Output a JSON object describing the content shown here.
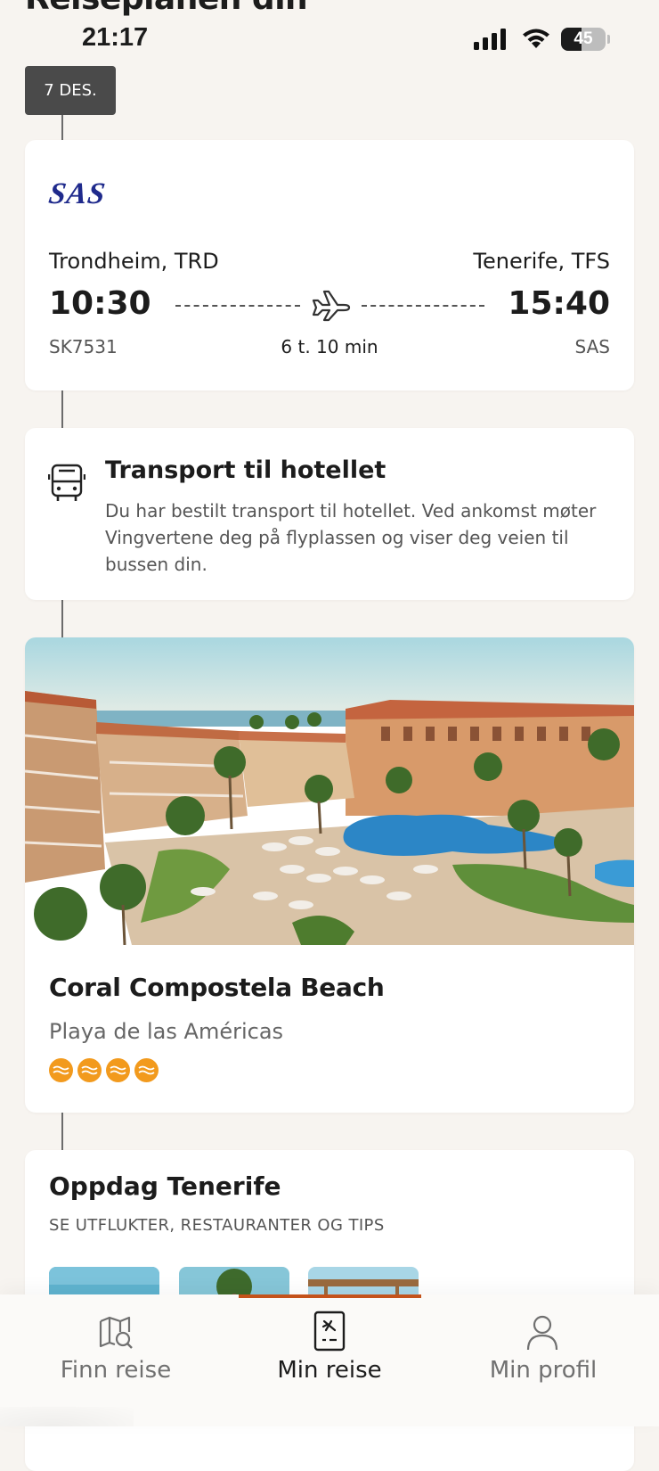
{
  "page": {
    "heading": "Reiseplanen din"
  },
  "status_bar": {
    "time": "21:17",
    "battery_percent": 45,
    "battery_label": "45"
  },
  "timeline": {
    "date_label": "7 DES."
  },
  "flight": {
    "airline_logo_text": "SAS",
    "from": "Trondheim, TRD",
    "to": "Tenerife, TFS",
    "departure_time": "10:30",
    "arrival_time": "15:40",
    "flight_number": "SK7531",
    "duration": "6 t. 10 min",
    "airline": "SAS",
    "icon": "airplane-icon"
  },
  "transport": {
    "icon": "bus-icon",
    "title": "Transport til hotellet",
    "description": "Du har bestilt transport til hotellet. Ved ankomst møter Vingvertene deg på flyplassen og viser deg veien til bussen din."
  },
  "hotel": {
    "name": "Coral Compostela Beach",
    "location": "Playa de las Américas",
    "rating": 4,
    "rating_icon": "sun-rating-icon",
    "rating_color": "#f29a1d"
  },
  "discover": {
    "title": "Oppdag Tenerife",
    "subtitle": "SE UTFLUKTER, RESTAURANTER OG TIPS"
  },
  "bottom_nav": {
    "items": [
      {
        "label": "Finn reise",
        "icon": "map-search-icon",
        "active": false
      },
      {
        "label": "Min reise",
        "icon": "ticket-plane-icon",
        "active": true
      },
      {
        "label": "Min profil",
        "icon": "person-icon",
        "active": false
      }
    ],
    "accent_color": "#c4521a"
  }
}
